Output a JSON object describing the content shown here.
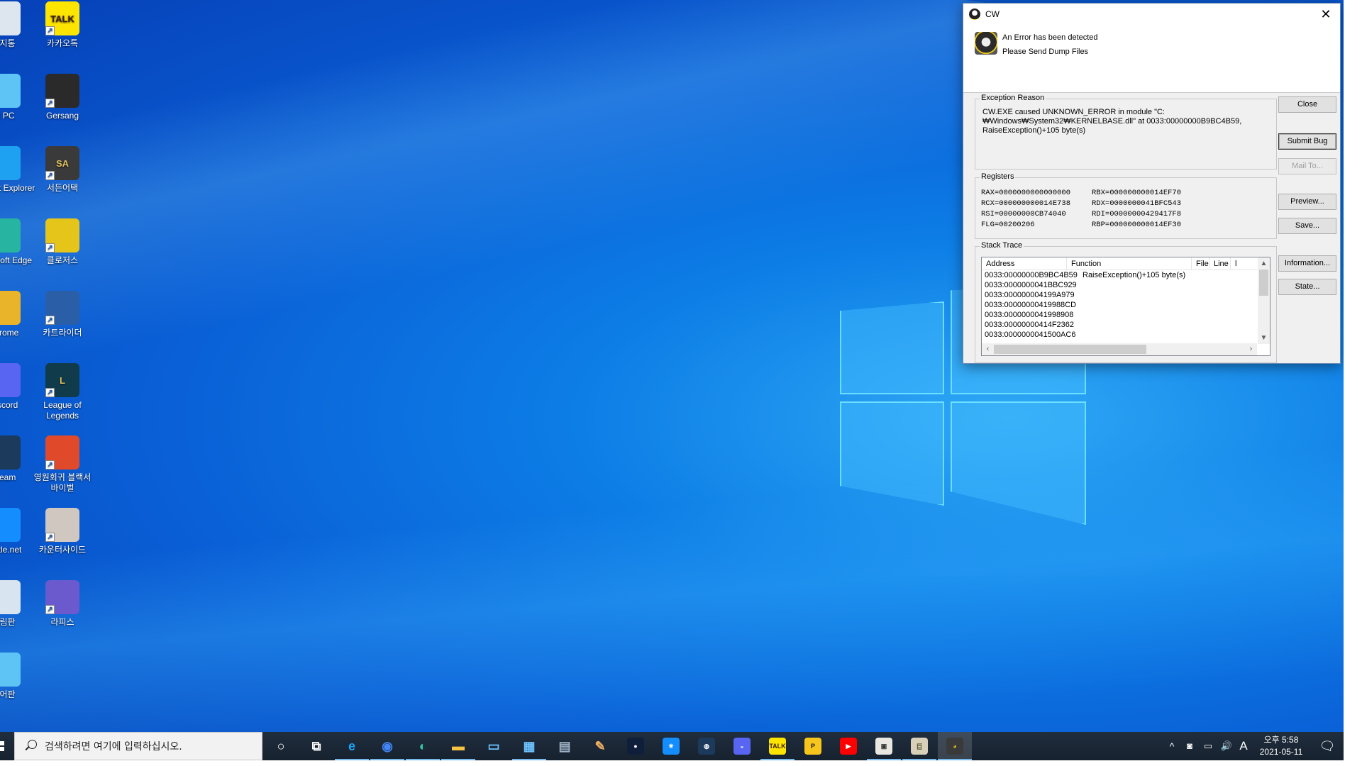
{
  "desktop": {
    "icons_col1": [
      {
        "label": "휴지통",
        "icon": "recycle-bin-icon"
      },
      {
        "label": "내 PC",
        "icon": "this-pc-icon"
      },
      {
        "label": "Internet Explorer",
        "icon": "internet-explorer-icon"
      },
      {
        "label": "Microsoft Edge",
        "icon": "edge-icon"
      },
      {
        "label": "Chrome",
        "icon": "chrome-icon"
      },
      {
        "label": "Discord",
        "icon": "discord-icon"
      },
      {
        "label": "Steam",
        "icon": "steam-icon"
      },
      {
        "label": "Battle.net",
        "icon": "battlenet-icon"
      },
      {
        "label": "그림판",
        "icon": "paint-icon"
      },
      {
        "label": "제어판",
        "icon": "control-panel-icon"
      }
    ],
    "icons_col2": [
      {
        "label": "카카오톡",
        "icon": "kakaotalk-icon",
        "glyph": "TALK"
      },
      {
        "label": "Gersang",
        "icon": "gersang-icon"
      },
      {
        "label": "서든어택",
        "icon": "sudden-attack-icon",
        "glyph": "SA"
      },
      {
        "label": "클로저스",
        "icon": "closers-icon"
      },
      {
        "label": "카트라이더",
        "icon": "kartrider-icon"
      },
      {
        "label": "League of Legends",
        "icon": "league-of-legends-icon",
        "glyph": "L"
      },
      {
        "label": "영원회귀 블랙서바이벌",
        "icon": "eternal-return-icon"
      },
      {
        "label": "카운터사이드",
        "icon": "counterside-icon"
      },
      {
        "label": "라피스",
        "icon": "lapis-icon"
      }
    ]
  },
  "dialog": {
    "title": "CW",
    "close_glyph": "✕",
    "header_line1": "An Error has been detected",
    "header_line2": "Please Send Dump Files",
    "exception": {
      "label": "Exception Reason",
      "text": "CW.EXE caused UNKNOWN_ERROR in module \"C:₩Windows₩System32₩KERNELBASE.dll\" at 0033:00000000B9BC4B59, RaiseException()+105 byte(s)"
    },
    "registers": {
      "label": "Registers",
      "rows": [
        [
          "RAX=0000000000000000",
          "RBX=000000000014EF70"
        ],
        [
          "RCX=000000000014E738",
          "RDX=0000000041BFC543"
        ],
        [
          "RSI=00000000CB74040",
          "RDI=00000000429417F8"
        ],
        [
          "FLG=00200206",
          "RBP=000000000014EF30"
        ]
      ]
    },
    "stack": {
      "label": "Stack Trace",
      "columns": [
        "Address",
        "Function",
        "File",
        "Line",
        "l"
      ],
      "rows": [
        {
          "address": "0033:00000000B9BC4B59",
          "function": "RaiseException()+105 byte(s)"
        },
        {
          "address": "0033:0000000041BBC929",
          "function": ""
        },
        {
          "address": "0033:000000004199A979",
          "function": ""
        },
        {
          "address": "0033:00000000419988CD",
          "function": ""
        },
        {
          "address": "0033:0000000041998908",
          "function": ""
        },
        {
          "address": "0033:00000000414F2362",
          "function": ""
        },
        {
          "address": "0033:0000000041500AC6",
          "function": ""
        }
      ]
    },
    "buttons": {
      "close": "Close",
      "submit_bug": "Submit Bug",
      "mail_to": "Mail To...",
      "preview": "Preview...",
      "save": "Save...",
      "information": "Information...",
      "state": "State..."
    }
  },
  "taskbar": {
    "search_placeholder": "검색하려면 여기에 입력하십시오.",
    "apps": [
      {
        "name": "cortana",
        "glyph": "○",
        "color": "#ffffff",
        "bg": "transparent"
      },
      {
        "name": "task-view",
        "glyph": "⧉",
        "color": "#ffffff",
        "bg": "transparent"
      },
      {
        "name": "internet-explorer",
        "glyph": "e",
        "color": "#1ea1f1",
        "bg": "transparent",
        "open": true
      },
      {
        "name": "chrome",
        "glyph": "◉",
        "color": "#4285f4",
        "bg": "transparent",
        "open": true
      },
      {
        "name": "edge",
        "glyph": "◐",
        "color": "#35c1a0",
        "bg": "transparent",
        "open": true
      },
      {
        "name": "file-explorer",
        "glyph": "▬",
        "color": "#f5c242",
        "bg": "transparent",
        "open": true
      },
      {
        "name": "this-pc",
        "glyph": "▭",
        "color": "#6cc3ff",
        "bg": "transparent"
      },
      {
        "name": "control-panel",
        "glyph": "▦",
        "color": "#6cc3ff",
        "bg": "transparent",
        "open": true
      },
      {
        "name": "calculator",
        "glyph": "▤",
        "color": "#9fb3c8",
        "bg": "transparent"
      },
      {
        "name": "paint",
        "glyph": "✎",
        "color": "#f0b060",
        "bg": "transparent"
      },
      {
        "name": "panda-app",
        "glyph": "●",
        "color": "#ffffff",
        "bg": "#0f1e3a"
      },
      {
        "name": "battle-net",
        "glyph": "✷",
        "color": "#ffffff",
        "bg": "#148eff"
      },
      {
        "name": "steam",
        "glyph": "◍",
        "color": "#ffffff",
        "bg": "#1b3a5c"
      },
      {
        "name": "discord",
        "glyph": "◒",
        "color": "#ffffff",
        "bg": "#5865f2"
      },
      {
        "name": "kakaotalk",
        "glyph": "TALK",
        "color": "#3c1e1e",
        "bg": "#fee500",
        "open": true
      },
      {
        "name": "kakao-yellow-app",
        "glyph": "P",
        "color": "#1e1e1e",
        "bg": "#f7c61c"
      },
      {
        "name": "youtube",
        "glyph": "▶",
        "color": "#ffffff",
        "bg": "#ff0000"
      },
      {
        "name": "game-launcher-1",
        "glyph": "▣",
        "color": "#333333",
        "bg": "#e8e8e0",
        "open": true
      },
      {
        "name": "game-launcher-2",
        "glyph": "巨",
        "color": "#553",
        "bg": "#d8d0b8",
        "open": true
      },
      {
        "name": "cw",
        "glyph": "◕",
        "color": "#e6c51a",
        "bg": "#3a3a3a",
        "active": true
      }
    ],
    "tray": {
      "show_hidden": "^",
      "input_indicator": "A",
      "time": "오후 5:58",
      "date": "2021-05-11"
    }
  }
}
